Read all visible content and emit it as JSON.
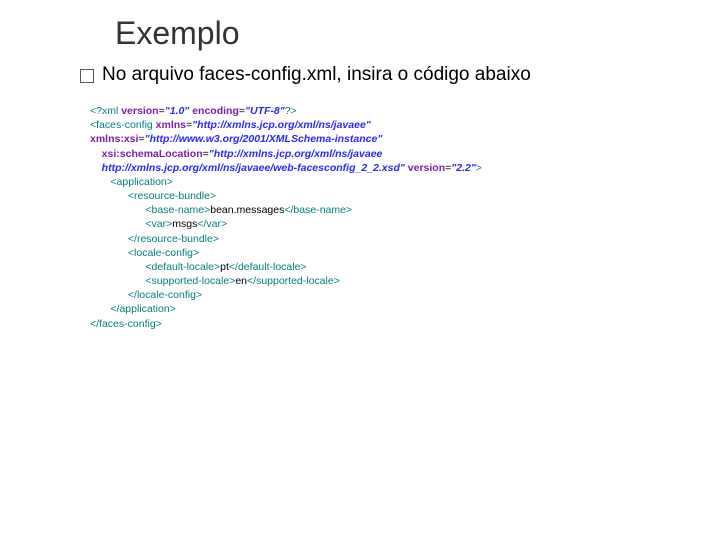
{
  "title": "Exemplo",
  "bullet_text": "No arquivo faces-config.xml, insira o código abaixo",
  "code": {
    "l1a": "<?xml ",
    "l1b": "version",
    "l1c": "=",
    "l1d": "\"1.0\"",
    "l1e": " encoding",
    "l1f": "=",
    "l1g": "\"UTF-8\"",
    "l1h": "?>",
    "l2a": "<faces-config ",
    "l2b": "xmlns",
    "l2c": "=",
    "l2d": "\"http://xmlns.jcp.org/xml/ns/javaee\"",
    "l3a": "xmlns:xsi",
    "l3b": "=",
    "l3c": "\"http://www.w3.org/2001/XMLSchema-instance\"",
    "l4a": "    xsi:schemaLocation",
    "l4b": "=",
    "l4c": "\"http://xmlns.jcp.org/xml/ns/javaee",
    "l5a": "    http://xmlns.jcp.org/xml/ns/javaee/web-facesconfig_2_2.xsd\"",
    "l5b": " version",
    "l5c": "=",
    "l5d": "\"2.2\"",
    "l5e": ">",
    "l6": "       <application>",
    "l7": "             <resource-bundle>",
    "l8a": "                   <base-name>",
    "l8b": "bean.messages",
    "l8c": "</base-name>",
    "l9a": "                   <var>",
    "l9b": "msgs",
    "l9c": "</var>",
    "l10": "             </resource-bundle>",
    "l11": "             <locale-config>",
    "l12a": "                   <default-locale>",
    "l12b": "pt",
    "l12c": "</default-locale>",
    "l13a": "                   <supported-locale>",
    "l13b": "en",
    "l13c": "</supported-locale>",
    "l14": "             </locale-config>",
    "l15": "       </application>",
    "l16": "</faces-config>"
  }
}
